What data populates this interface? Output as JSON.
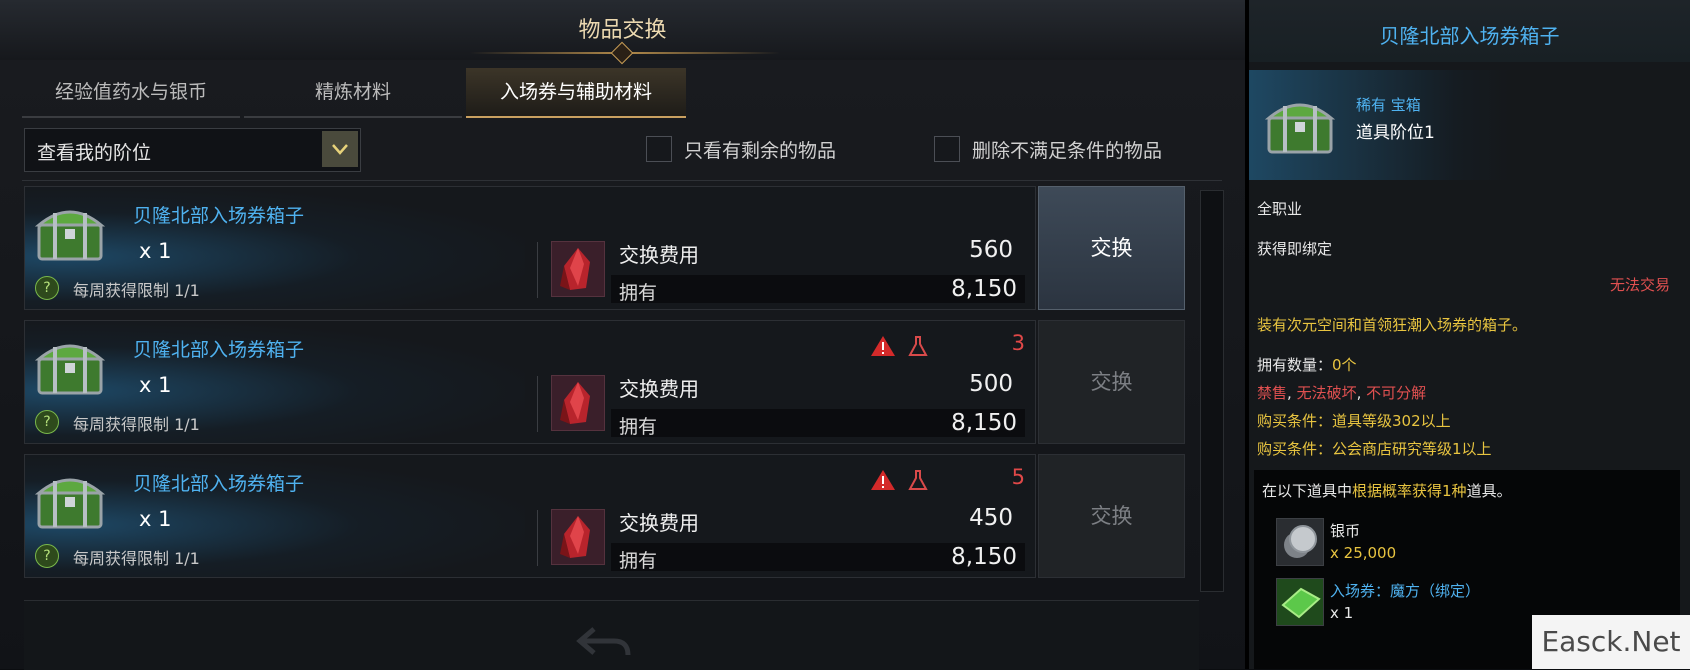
{
  "window": {
    "title": "物品交换"
  },
  "tabs": [
    {
      "label": "经验值药水与银币",
      "active": false
    },
    {
      "label": "精炼材料",
      "active": false
    },
    {
      "label": "入场券与辅助材料",
      "active": true
    }
  ],
  "filter": {
    "dropdown_value": "查看我的阶位",
    "checkbox1_label": "只看有剩余的物品",
    "checkbox1_checked": false,
    "checkbox2_label": "删除不满足条件的物品",
    "checkbox2_checked": false
  },
  "rows": [
    {
      "name": "贝隆北部入场券箱子",
      "qty": "x 1",
      "limit": "每周获得限制 1/1",
      "cost_label": "交换费用",
      "cost": "560",
      "own_label": "拥有",
      "own": "8,150",
      "warning_count": "",
      "button": "交换",
      "enabled": true
    },
    {
      "name": "贝隆北部入场券箱子",
      "qty": "x 1",
      "limit": "每周获得限制 1/1",
      "cost_label": "交换费用",
      "cost": "500",
      "own_label": "拥有",
      "own": "8,150",
      "warning_count": "3",
      "button": "交换",
      "enabled": false
    },
    {
      "name": "贝隆北部入场券箱子",
      "qty": "x 1",
      "limit": "每周获得限制 1/1",
      "cost_label": "交换费用",
      "cost": "450",
      "own_label": "拥有",
      "own": "8,150",
      "warning_count": "5",
      "button": "交换",
      "enabled": false
    }
  ],
  "tooltip": {
    "title": "贝隆北部入场券箱子",
    "rarity": "稀有 宝箱",
    "tier": "道具阶位1",
    "class": "全职业",
    "bind": "获得即绑定",
    "trade": "无法交易",
    "description": "装有次元空间和首领狂潮入场券的箱子。",
    "own_count_label": "拥有数量：",
    "own_count_value": "0个",
    "restrict_1": "禁售",
    "restrict_sep1": ", ",
    "restrict_2": "无法破坏",
    "restrict_sep2": ", ",
    "restrict_3": "不可分解",
    "condition_1": "购买条件：道具等级302以上",
    "condition_2": "购买条件：公会商店研究等级1以上",
    "box_intro_prefix": "在以下道具中",
    "box_intro_highlight": "根据概率获得1种",
    "box_intro_suffix": "道具。",
    "rewards": [
      {
        "name": "银币",
        "qty": "x 25,000",
        "icon": "silver-coin-icon"
      },
      {
        "name": "入场券：魔方（绑定）",
        "qty": "x 1",
        "icon": "cube-ticket-icon"
      }
    ]
  },
  "watermark": "Easck.Net",
  "colors": {
    "item_blue": "#4fb2f0",
    "warning_red": "#e04848",
    "condition_yellow": "#e8c440",
    "gold_accent": "#c9a060"
  }
}
